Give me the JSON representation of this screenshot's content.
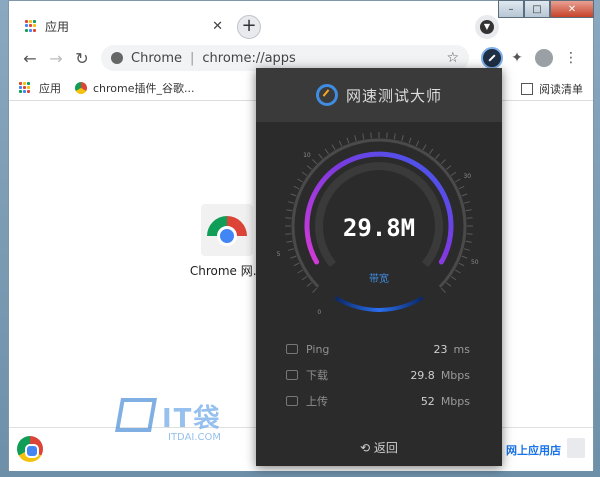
{
  "window": {
    "min": "–",
    "max": "□",
    "close": "✕"
  },
  "tab": {
    "title": "应用",
    "close": "✕",
    "new_tab": "+"
  },
  "toolbar": {
    "back": "←",
    "forward": "→",
    "reload": "↻",
    "site_name": "Chrome",
    "separator": "|",
    "url": "chrome://apps",
    "star": "☆",
    "extensions": "✦",
    "menu": "⋮"
  },
  "bookmarks": {
    "apps": "应用",
    "item1": "chrome插件_谷歌...",
    "reading_list": "阅读清单"
  },
  "app": {
    "label": "Chrome 网..."
  },
  "footer": {
    "store": "网上应用店"
  },
  "watermark": {
    "text": "IT袋",
    "domain": "ITDAI.COM"
  },
  "speedtest": {
    "title": "网速测试大师",
    "value": "29.8M",
    "band_label": "带宽",
    "ticks": [
      "0",
      "5",
      "10",
      "20",
      "30",
      "50",
      "100"
    ],
    "rows": [
      {
        "label": "Ping",
        "value": "23",
        "unit": "ms"
      },
      {
        "label": "下载",
        "value": "29.8",
        "unit": "Mbps"
      },
      {
        "label": "上传",
        "value": "52",
        "unit": "Mbps"
      }
    ],
    "back": "返回"
  },
  "colors": {
    "accent_blue": "#3f8ce0",
    "gauge_purple": "#c239e0",
    "popup_bg": "#2b2b2b"
  }
}
